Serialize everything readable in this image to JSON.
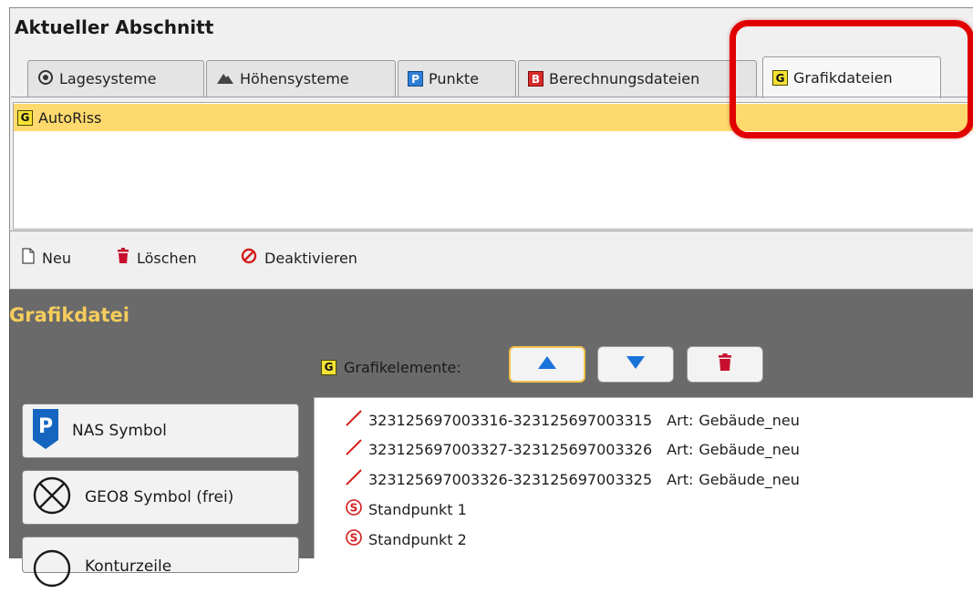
{
  "section": {
    "title": "Aktueller Abschnitt",
    "tabs": [
      {
        "label": "Lagesysteme",
        "icon": "target-icon"
      },
      {
        "label": "Höhensysteme",
        "icon": "mountain-icon"
      },
      {
        "label": "Punkte",
        "icon": "p-badge-icon",
        "badge": "P"
      },
      {
        "label": "Berechnungsdateien",
        "icon": "b-badge-icon",
        "badge": "B"
      },
      {
        "label": "Grafikdateien",
        "icon": "g-badge-icon",
        "badge": "G",
        "active": true
      }
    ],
    "list_items": [
      {
        "label": "AutoRiss",
        "badge": "G",
        "selected": true
      }
    ]
  },
  "toolbar": {
    "new_label": "Neu",
    "delete_label": "Löschen",
    "deactivate_label": "Deaktivieren"
  },
  "grafikdatei": {
    "title": "Grafikdatei",
    "elements_label": "Grafikelemente:",
    "elements_badge": "G",
    "side_buttons": [
      {
        "label": "NAS Symbol",
        "icon": "parking-symbol-icon"
      },
      {
        "label": "GEO8 Symbol (frei)",
        "icon": "circle-x-icon"
      },
      {
        "label": "Konturzeile",
        "icon": "circle-icon"
      }
    ],
    "elements": [
      {
        "icon": "line-icon",
        "text": "323125697003316-323125697003315",
        "art_label": "Art:",
        "art_value": "Gebäude_neu"
      },
      {
        "icon": "line-icon",
        "text": "323125697003327-323125697003326",
        "art_label": "Art:",
        "art_value": "Gebäude_neu"
      },
      {
        "icon": "line-icon",
        "text": "323125697003326-323125697003325",
        "art_label": "Art:",
        "art_value": "Gebäude_neu"
      },
      {
        "icon": "standpunkt-icon",
        "text": "Standpunkt 1"
      },
      {
        "icon": "standpunkt-icon",
        "text": "Standpunkt 2"
      }
    ]
  },
  "colors": {
    "selection": "#fdd96e",
    "highlight_frame": "#e10000",
    "section_title": "#f5cd5d",
    "arrow_blue": "#1a73d9",
    "delete_red": "#c8102e"
  }
}
